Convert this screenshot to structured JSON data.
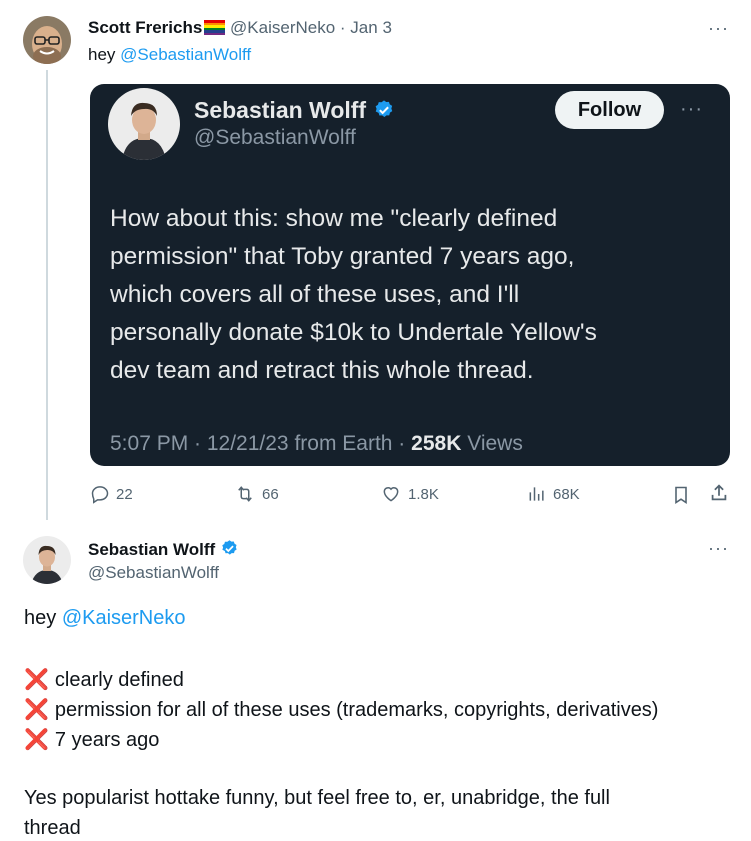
{
  "tweet1": {
    "author_name": "Scott Frerichs",
    "author_handle": "@KaiserNeko",
    "date": "· Jan 3",
    "text_prefix": "hey",
    "mention": "@SebastianWolff"
  },
  "embed": {
    "author_name": "Sebastian Wolff",
    "author_handle": "@SebastianWolff",
    "follow_label": "Follow",
    "lines": [
      "How about this: show me \"clearly defined",
      "permission\" that Toby granted 7 years ago,",
      "which covers all of these uses, and I'll",
      "personally donate $10k to Undertale Yellow's",
      "dev team and retract this whole thread."
    ],
    "meta_time": "5:07 PM · 12/21/23 from Earth ·",
    "meta_views_count": "258K",
    "meta_views_label": "Views"
  },
  "actions": {
    "replies": "22",
    "retweets": "66",
    "likes": "1.8K",
    "views": "68K"
  },
  "tweet2": {
    "author_name": "Sebastian Wolff",
    "author_handle": "@SebastianWolff",
    "greeting_prefix": "hey",
    "greeting_mention": "@KaiserNeko",
    "items": [
      "clearly defined",
      "permission for all of these uses (trademarks, copyrights, derivatives)",
      "7 years ago"
    ],
    "closing_line1": "Yes popularist hottake funny, but feel free to, er, unabridge, the full",
    "closing_line2": "thread"
  },
  "icons": {
    "cross": "❌",
    "more": "···"
  },
  "colors": {
    "link": "#1d9bf0",
    "verified": "#1d9bf0",
    "embed_bg": "#15202b",
    "cross": "#e0245e"
  }
}
